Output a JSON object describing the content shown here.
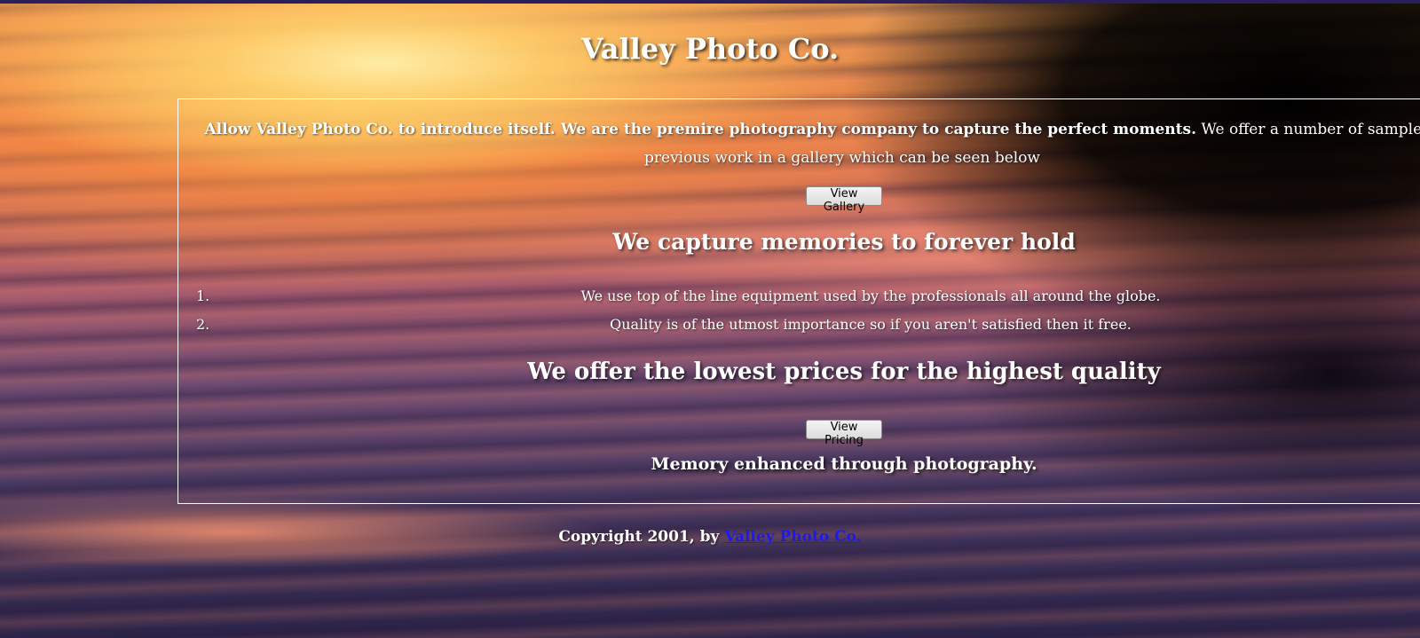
{
  "site": {
    "title": "Valley Photo Co."
  },
  "intro": {
    "bold_text": "Allow Valley Photo Co. to introduce itself. We are the premire photography company to capture the perfect moments.",
    "regular_text": " We offer a number of samples of our previous work in a gallery which can be seen below"
  },
  "buttons": {
    "gallery_label": "View Gallery",
    "pricing_label": "View Pricing"
  },
  "headings": {
    "capture": "We capture memories to forever hold",
    "prices": "We offer the lowest prices for the highest quality",
    "tagline": "Memory enhanced through photography."
  },
  "features": [
    {
      "number": "1.",
      "text": "We use top of the line equipment used by the professionals all around the globe."
    },
    {
      "number": "2.",
      "text": "Quality is of the utmost importance so if you aren't satisfied then it free."
    }
  ],
  "footer": {
    "prefix": "Copyright 2001, by ",
    "link_text": "Valley Photo Co."
  },
  "colors": {
    "text": "#ffffff",
    "link": "#1a1aee",
    "border": "#ffffff",
    "topbar": "#2a1f5a"
  },
  "background": {
    "description_icon": "sunset-water-image"
  }
}
